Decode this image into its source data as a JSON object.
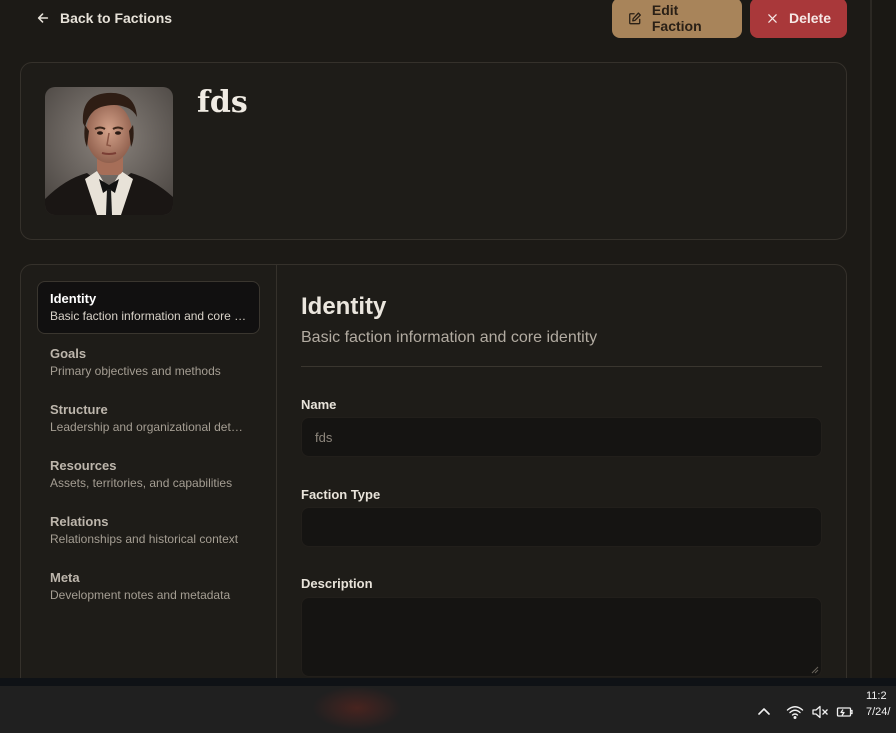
{
  "header": {
    "back_label": "Back to Factions",
    "edit_label": "Edit Faction",
    "delete_label": "Delete"
  },
  "faction": {
    "name": "fds"
  },
  "sidebar": {
    "items": [
      {
        "title": "Identity",
        "desc": "Basic faction information and core identity",
        "active": true
      },
      {
        "title": "Goals",
        "desc": "Primary objectives and methods"
      },
      {
        "title": "Structure",
        "desc": "Leadership and organizational details"
      },
      {
        "title": "Resources",
        "desc": "Assets, territories, and capabilities"
      },
      {
        "title": "Relations",
        "desc": "Relationships and historical context"
      },
      {
        "title": "Meta",
        "desc": "Development notes and metadata"
      }
    ]
  },
  "section": {
    "title": "Identity",
    "description": "Basic faction information and core identity",
    "fields": {
      "name_label": "Name",
      "name_value": "fds",
      "type_label": "Faction Type",
      "type_value": "",
      "description_label": "Description",
      "description_value": ""
    }
  },
  "taskbar": {
    "time": "11:2",
    "date": "7/24/"
  },
  "colors": {
    "accent_edit": "#a8845a",
    "accent_delete": "#a9383a",
    "background": "#1c1a16"
  }
}
